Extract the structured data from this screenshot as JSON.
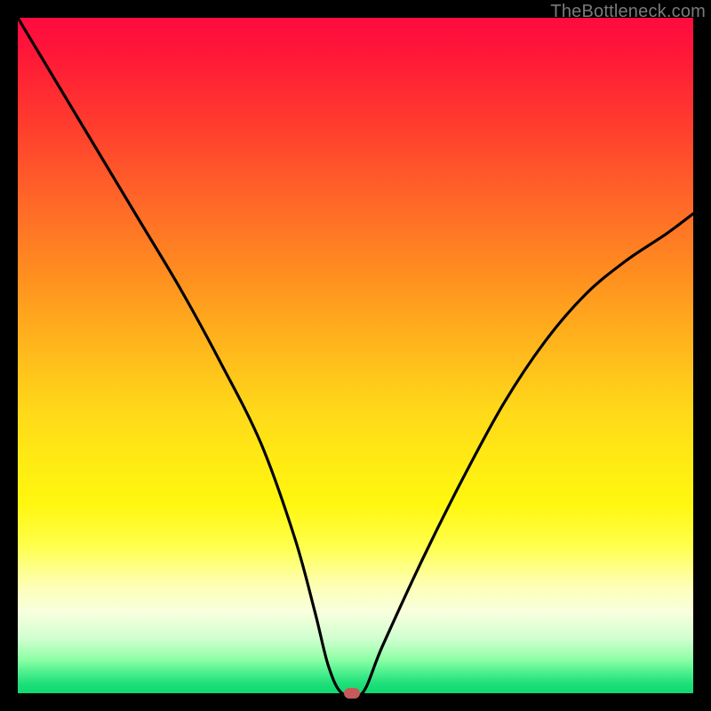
{
  "watermark": "TheBottleneck.com",
  "colors": {
    "background": "#000000",
    "curve": "#000000",
    "marker": "#c65a5a"
  },
  "chart_data": {
    "type": "line",
    "title": "",
    "xlabel": "",
    "ylabel": "",
    "xlim": [
      0,
      100
    ],
    "ylim": [
      0,
      100
    ],
    "grid": false,
    "legend": false,
    "series": [
      {
        "name": "bottleneck-curve",
        "x": [
          0,
          6,
          12,
          18,
          24,
          30,
          36,
          41,
          44,
          46,
          48,
          51,
          54,
          60,
          66,
          72,
          78,
          84,
          90,
          96,
          100
        ],
        "values": [
          100,
          90,
          80,
          70,
          60,
          49,
          37,
          23,
          12,
          4,
          0,
          0,
          7,
          20,
          32,
          43,
          52,
          59,
          64,
          68,
          71
        ]
      }
    ],
    "marker": {
      "x": 49.5,
      "y": 0
    },
    "background_gradient": {
      "direction": "vertical",
      "stops": [
        {
          "pos": 0.0,
          "color": "#ff0b3f"
        },
        {
          "pos": 0.28,
          "color": "#ff6a28"
        },
        {
          "pos": 0.58,
          "color": "#ffd81a"
        },
        {
          "pos": 0.84,
          "color": "#feffb4"
        },
        {
          "pos": 1.0,
          "color": "#10d872"
        }
      ]
    }
  }
}
